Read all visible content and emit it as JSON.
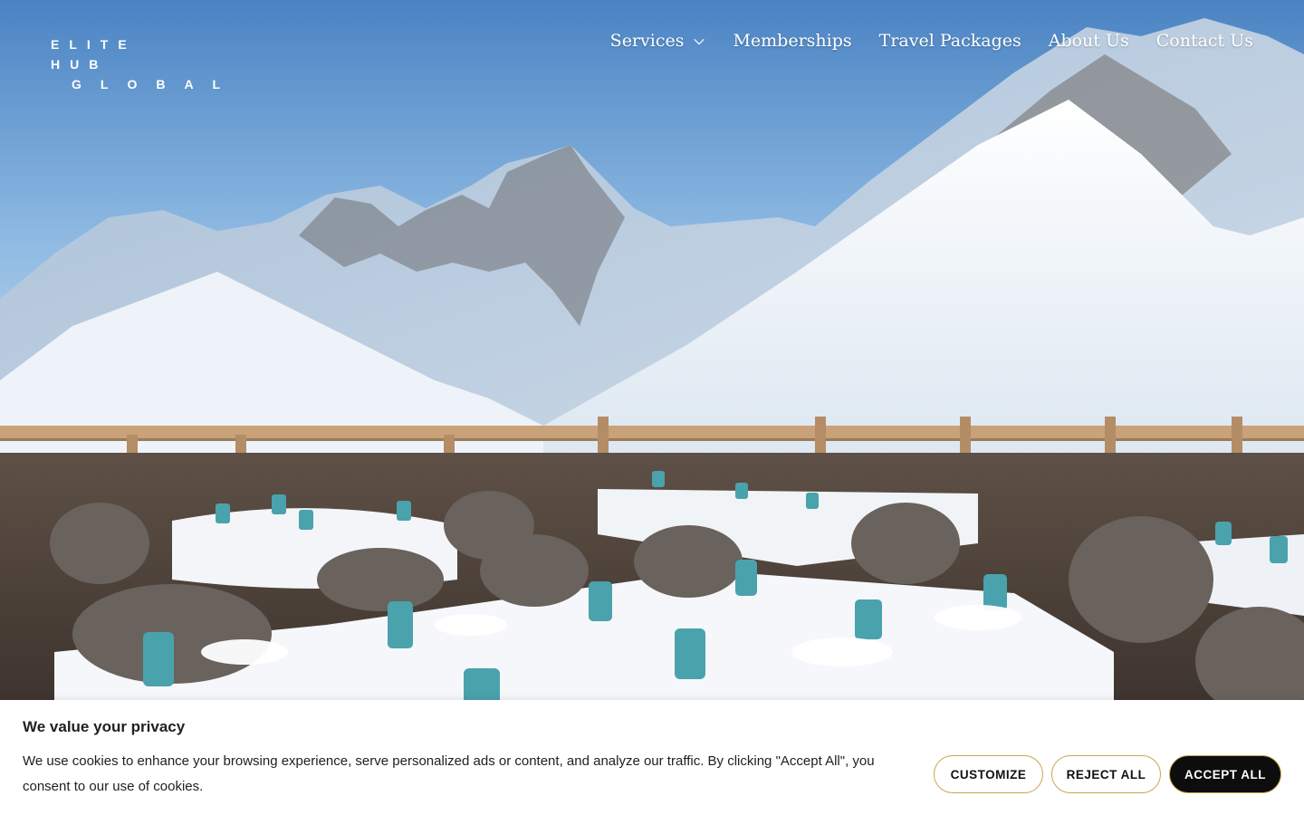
{
  "brand": {
    "line1": "ELITE HUB",
    "line2": "GLOBAL"
  },
  "nav": {
    "items": [
      {
        "label": "Services",
        "has_dropdown": true
      },
      {
        "label": "Memberships"
      },
      {
        "label": "Travel Packages"
      },
      {
        "label": "About Us"
      },
      {
        "label": "Contact Us"
      }
    ]
  },
  "cookie_banner": {
    "title": "We value your privacy",
    "message": "We use cookies to enhance your browsing experience, serve personalized ads or content, and analyze our traffic. By clicking \"Accept All\", you consent to our use of cookies.",
    "customize_label": "CUSTOMIZE",
    "reject_label": "REJECT ALL",
    "accept_label": "ACCEPT ALL"
  },
  "colors": {
    "button_border": "#c9a84a",
    "accept_bg": "#0d0d0d",
    "text": "#212121"
  },
  "icons": {
    "dropdown": "chevron-down-icon"
  }
}
